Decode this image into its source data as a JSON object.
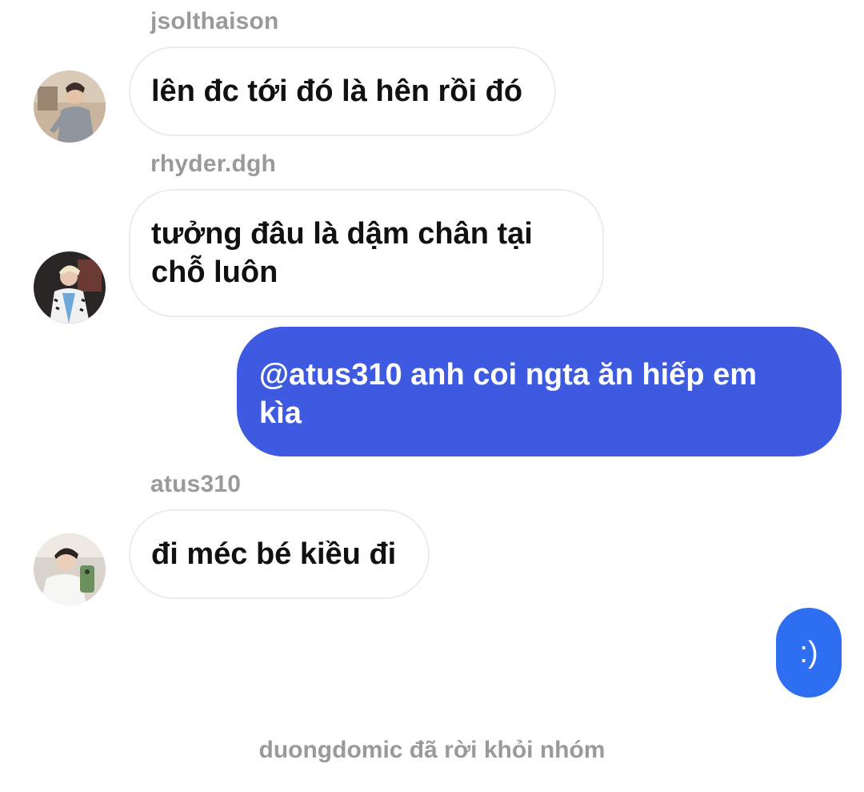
{
  "messages": [
    {
      "sender": "jsolthaison",
      "text": "lên đc tới đó là hên rồi đó",
      "avatar_icon": "user-avatar-jsolthaison"
    },
    {
      "sender": "rhyder.dgh",
      "text_line1": "tưởng đâu là dậm chân tại",
      "text_line2": "chỗ luôn",
      "avatar_icon": "user-avatar-rhyder"
    },
    {
      "outgoing_line1": "@atus310 anh coi ngta ăn hiếp em",
      "outgoing_line2": "kìa"
    },
    {
      "sender": "atus310",
      "text": "đi méc bé kiều đi",
      "avatar_icon": "user-avatar-atus310"
    },
    {
      "outgoing": ":)"
    }
  ],
  "system_message": "duongdomic đã rời khỏi nhóm",
  "colors": {
    "outgoing_bubble": "#3d5ae0",
    "outgoing_small_bubble": "#2d6ff0",
    "incoming_border": "#ececec",
    "sender_text": "#9a9a9a"
  }
}
